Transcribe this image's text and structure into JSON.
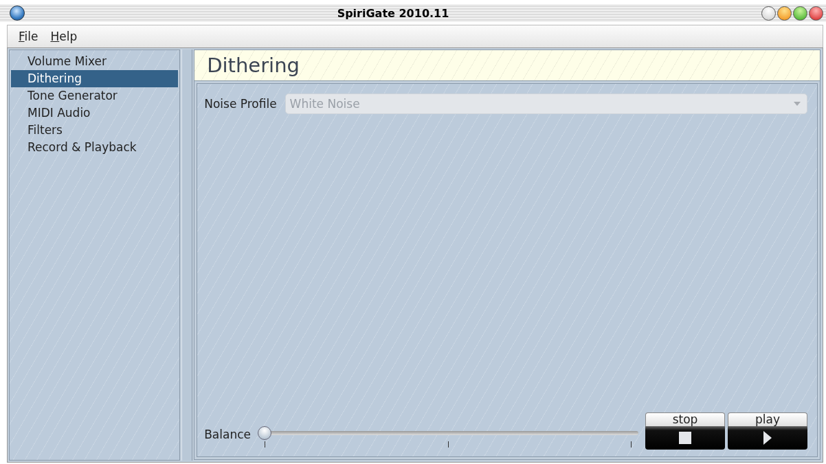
{
  "window": {
    "title": "SpiriGate 2010.11"
  },
  "menu": [
    {
      "label": "File"
    },
    {
      "label": "Help"
    }
  ],
  "sidebar": {
    "items": [
      {
        "label": "Volume Mixer",
        "selected": false
      },
      {
        "label": "Dithering",
        "selected": true
      },
      {
        "label": "Tone Generator",
        "selected": false
      },
      {
        "label": "MIDI Audio",
        "selected": false
      },
      {
        "label": "Filters",
        "selected": false
      },
      {
        "label": "Record & Playback",
        "selected": false
      }
    ]
  },
  "panel": {
    "heading": "Dithering",
    "noise_profile": {
      "label": "Noise Profile",
      "value": "White Noise",
      "disabled": true
    },
    "balance": {
      "label": "Balance",
      "level": 0
    },
    "buttons": [
      {
        "label": "stop",
        "kind": "stop"
      },
      {
        "label": "play",
        "kind": "play"
      }
    ]
  }
}
